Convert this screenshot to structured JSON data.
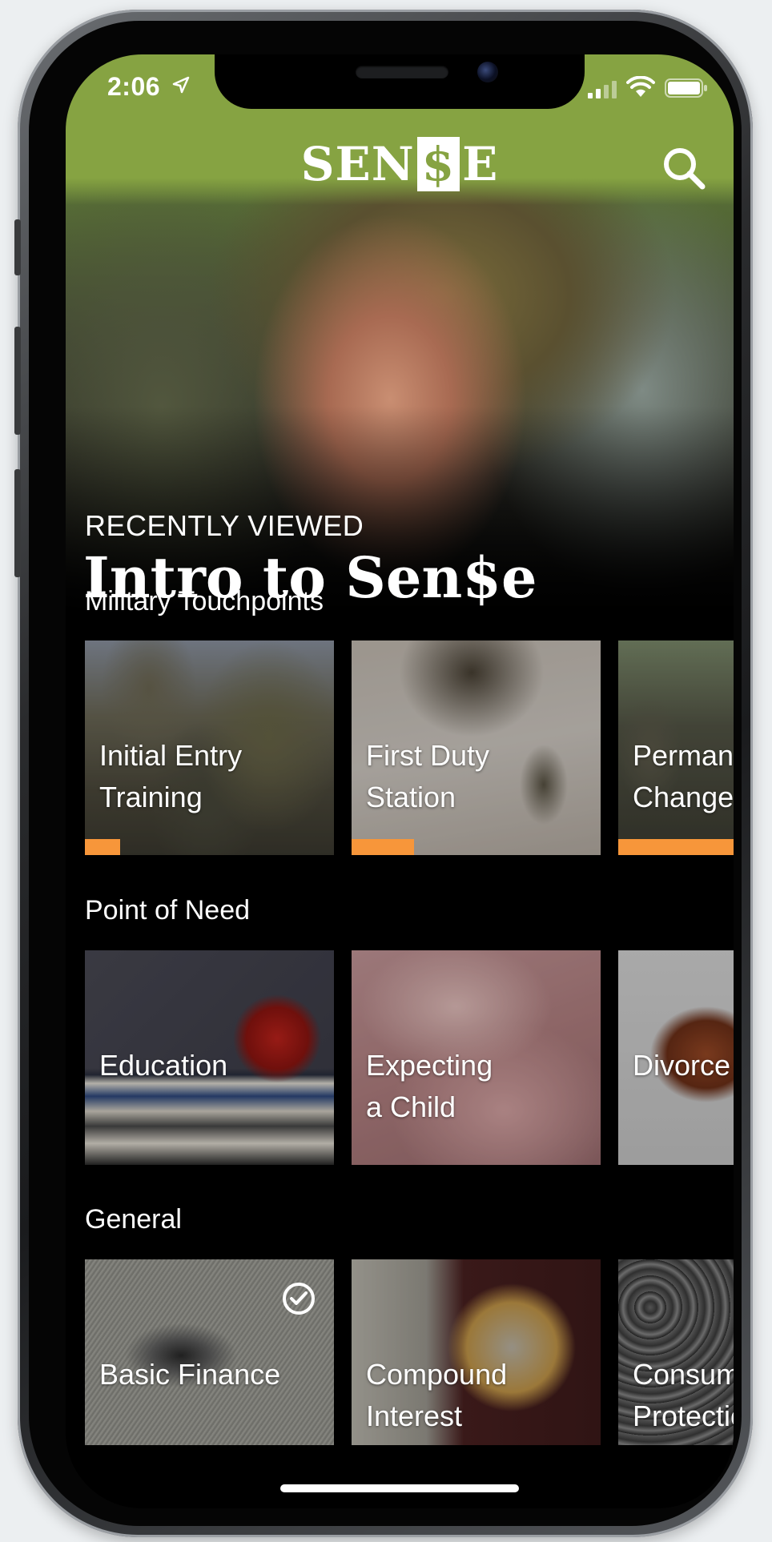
{
  "status_bar": {
    "time": "2:06",
    "icons": [
      "location-arrow-icon",
      "signal-icon",
      "wifi-icon",
      "battery-icon"
    ]
  },
  "header": {
    "logo_left": "SEN",
    "logo_mark": "$",
    "logo_right": "E",
    "search_icon": "search-icon"
  },
  "hero": {
    "overline": "RECENTLY VIEWED",
    "title": "Intro to Sen$e"
  },
  "sections": [
    {
      "title": "Military Touchpoints",
      "cards": [
        {
          "label": "Initial Entry\nTraining",
          "progress": 0.14
        },
        {
          "label": "First Duty\nStation",
          "progress": 0.25
        },
        {
          "label": "Permanent\nChange",
          "progress": 0.5
        }
      ]
    },
    {
      "title": "Point of Need",
      "cards": [
        {
          "label": "Education"
        },
        {
          "label": "Expecting\na Child"
        },
        {
          "label": "Divorce"
        }
      ]
    },
    {
      "title": "General",
      "cards": [
        {
          "label": "Basic Finance",
          "completed": true
        },
        {
          "label": "Compound\nInterest"
        },
        {
          "label": "Consumer\nProtection"
        }
      ]
    }
  ],
  "colors": {
    "brand_green": "#86a342",
    "progress_orange": "#f7963a",
    "background": "#000000"
  }
}
